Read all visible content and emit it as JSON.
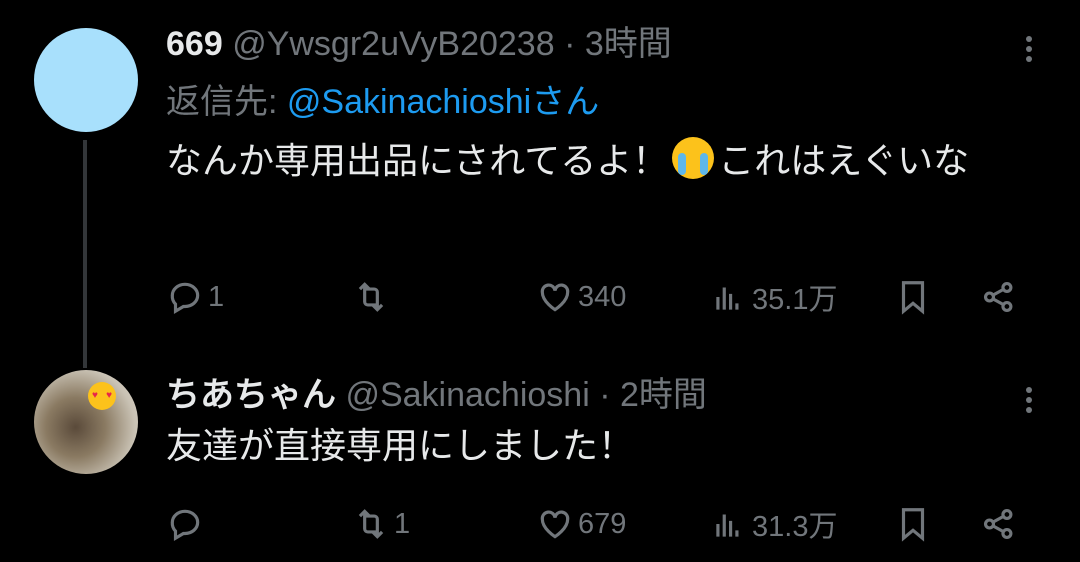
{
  "tweets": [
    {
      "name": "669",
      "handle": "@Ywsgr2uVyB20238",
      "dot": "·",
      "time": "3時間",
      "reply_prefix": "返信先: ",
      "reply_mention": "@Sakinachioshiさん",
      "text_part1": "なんか専用出品にされてるよ！",
      "text_part2": "これはえぐいな",
      "emoji": "loudly-crying-face",
      "avatar_color": "#a8e0fc",
      "replies": "1",
      "retweets": "",
      "likes": "340",
      "views": "35.1万"
    },
    {
      "name": "ちあちゃん",
      "handle": "@Sakinachioshi",
      "dot": "·",
      "time": "2時間",
      "text": "友達が直接専用にしました！",
      "replies": "",
      "retweets": "1",
      "likes": "679",
      "views": "31.3万"
    }
  ],
  "colors": {
    "background": "#000000",
    "text": "#e7e9ea",
    "muted": "#71767b",
    "link": "#1d9bf0"
  }
}
